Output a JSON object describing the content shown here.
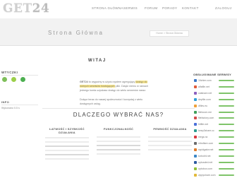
{
  "header": {
    "logo_letters": "GET",
    "logo_digits": "24",
    "nav": [
      "STRONA GŁÓWNA",
      "SERWIS",
      "FORUM",
      "PORADY",
      "KONTAKT",
      "ZALOGUJ"
    ]
  },
  "hero": {
    "title": "Strona Główna",
    "breadcrumb": "Home > Strona Główna"
  },
  "left": {
    "widgets_title": "WTYCZKI",
    "info_title": "INFO",
    "info_text": "Wykonano 0.5 s"
  },
  "welcome": {
    "title": "WITAJ",
    "brand": "GET24",
    "intro_text_1": "to wygodny w użyciu system agregujący",
    "intro_highlight": "dostęp do różnych serwisów hostujących",
    "intro_text_2": "pliki. Dzięki niemu w ramach jednego konta uzyskasz dostęp do wielu serwerów naraz.",
    "intro_text_3": "Dołącz teraz do naszej społeczności i korzystaj z wielu dostępnych usług."
  },
  "why": {
    "title": "DLACZEGO WYBRAĆ NAS?",
    "columns": [
      {
        "title": "ŁATWOŚĆ I SZYBKOŚĆ DZIAŁANIA"
      },
      {
        "title": "FUNKCJONALNOŚĆ"
      },
      {
        "title": "PEWNOŚĆ DZIAŁANIA"
      }
    ]
  },
  "services": {
    "title": "OBSŁUGIWANE SERWISY",
    "items": [
      {
        "name": "1fichier.com",
        "color": "#3a78c8",
        "bar": "#7fc46a"
      },
      {
        "name": "alfafile.net",
        "color": "#e05b3a",
        "bar": "#7fc46a"
      },
      {
        "name": "catshare.net",
        "color": "#8b5fbf",
        "bar": "#7fc46a"
      },
      {
        "name": "depfile.com",
        "color": "#2e9fd8",
        "bar": "#7fc46a"
      },
      {
        "name": "dfiles.eu",
        "color": "#f0a13a",
        "bar": "#7fc46a"
      },
      {
        "name": "fileboom.me",
        "color": "#3f9f5a",
        "bar": "#7fc46a"
      },
      {
        "name": "filefactory.com",
        "color": "#d24b4b",
        "bar": "#7fc46a"
      },
      {
        "name": "hitfile.net",
        "color": "#4a6fd8",
        "bar": "#7fc46a"
      },
      {
        "name": "keep2share.cc",
        "color": "#2b9b8f",
        "bar": "#7fc46a"
      },
      {
        "name": "mega.nz",
        "color": "#d9363e",
        "bar": "#7fc46a"
      },
      {
        "name": "nitroflare.com",
        "color": "#6b6b6b",
        "bar": "#7fc46a"
      },
      {
        "name": "rapidgator.net",
        "color": "#e07b2a",
        "bar": "#7fc46a"
      },
      {
        "name": "turbobit.net",
        "color": "#3c87c6",
        "bar": "#7fc46a"
      },
      {
        "name": "uploaded.net",
        "color": "#2c5aa0",
        "bar": "#7fc46a"
      },
      {
        "name": "uptobox.com",
        "color": "#8fbf3a",
        "bar": "#7fc46a"
      },
      {
        "name": "zippyshare.com",
        "color": "#e2b93a",
        "bar": "#7fc46a"
      }
    ]
  },
  "colors": {
    "highlight": "#fbe88c",
    "hero_bg": "#f2f2f2",
    "plugin_1": "#7fbf5a",
    "plugin_2": "#9ccf4a",
    "plugin_3": "#4caf50"
  }
}
